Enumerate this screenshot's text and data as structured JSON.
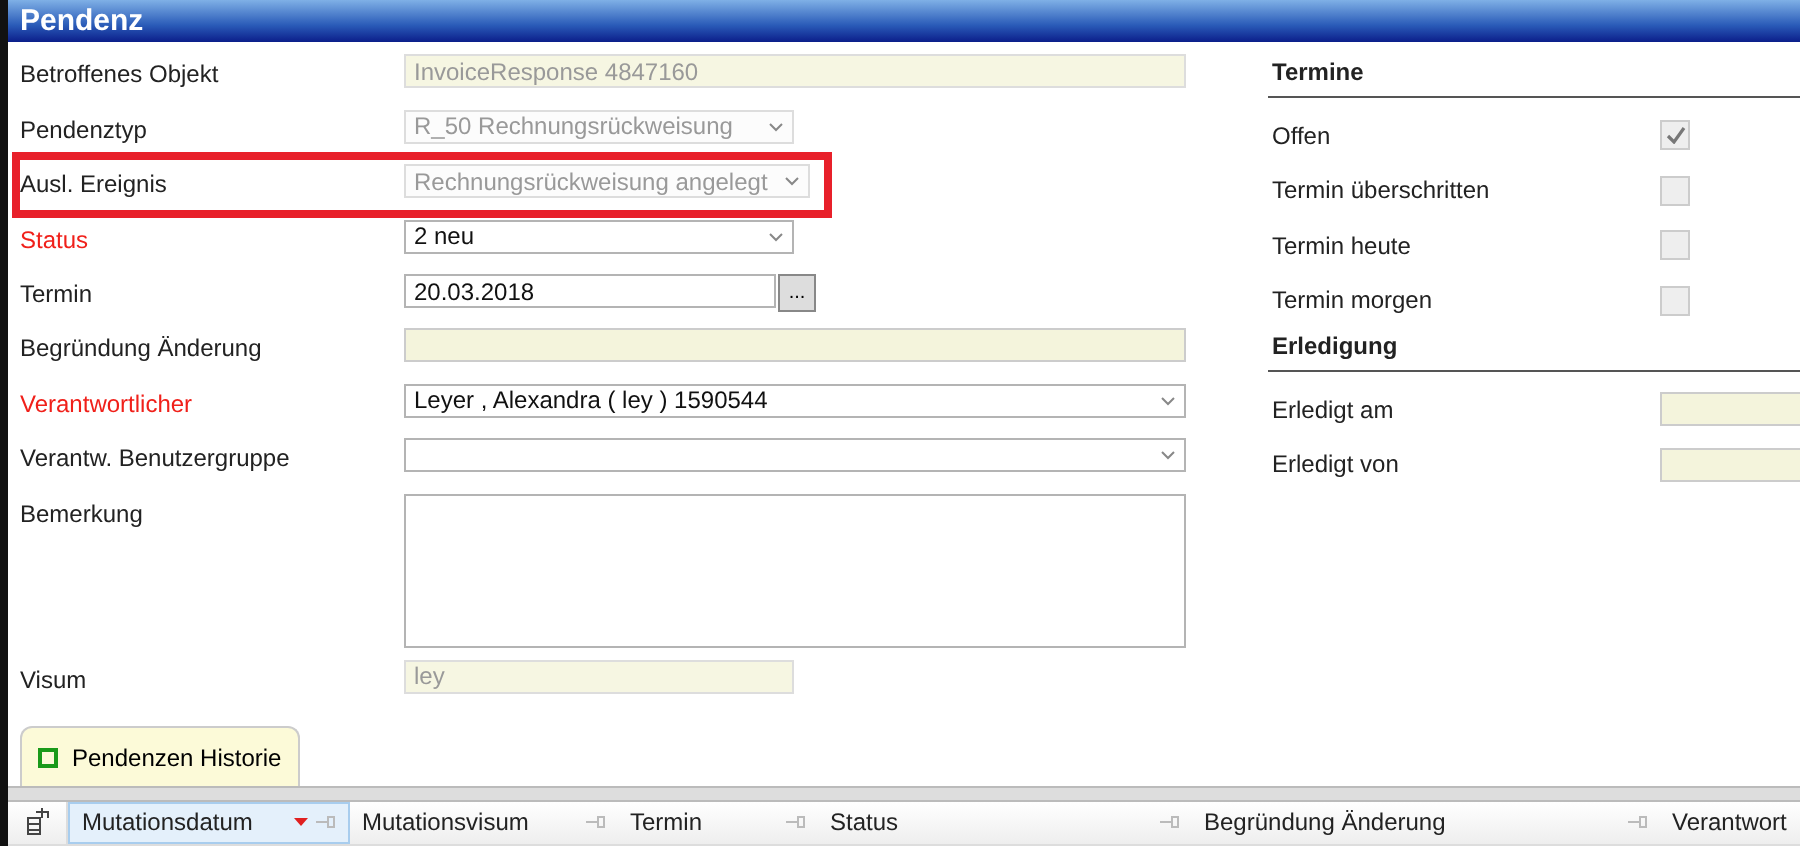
{
  "window": {
    "title": "Pendenz"
  },
  "fields": [
    {
      "label": "Betroffenes Objekt",
      "kind": "readonly",
      "value": "InvoiceResponse 4847160",
      "required": false,
      "disabled": true,
      "highlighted": false
    },
    {
      "label": "Pendenztyp",
      "kind": "select",
      "value": "R_50 Rechnungsrückweisung",
      "required": false,
      "disabled": true,
      "highlighted": false
    },
    {
      "label": "Ausl. Ereignis",
      "kind": "select",
      "value": "Rechnungsrückweisung angelegt",
      "required": false,
      "disabled": true,
      "highlighted": true
    },
    {
      "label": "Status",
      "kind": "select",
      "value": "2 neu",
      "required": true,
      "disabled": false,
      "highlighted": false
    },
    {
      "label": "Termin",
      "kind": "date",
      "value": "20.03.2018",
      "button": "...",
      "required": false,
      "disabled": false,
      "highlighted": false
    },
    {
      "label": "Begründung Änderung",
      "kind": "readonly",
      "required": false,
      "disabled": false,
      "highlighted": false
    },
    {
      "label": "Verantwortlicher",
      "kind": "select",
      "value": "Leyer , Alexandra  ( ley ) 1590544",
      "required": true,
      "disabled": false,
      "highlighted": false
    },
    {
      "label": "Verantw. Benutzergruppe",
      "kind": "select",
      "required": false,
      "disabled": false,
      "highlighted": false
    },
    {
      "label": "Bemerkung",
      "kind": "textarea",
      "required": false,
      "disabled": false,
      "highlighted": false
    },
    {
      "label": "Visum",
      "kind": "readonly",
      "value": "ley",
      "required": false,
      "disabled": true,
      "highlighted": false
    }
  ],
  "side_sections": [
    {
      "title": "Termine",
      "items": [
        {
          "label": "Offen",
          "kind": "checkbox",
          "checked": true
        },
        {
          "label": "Termin überschritten",
          "kind": "checkbox",
          "checked": false
        },
        {
          "label": "Termin heute",
          "kind": "checkbox",
          "checked": false
        },
        {
          "label": "Termin morgen",
          "kind": "checkbox",
          "checked": false
        }
      ]
    },
    {
      "title": "Erledigung",
      "items": [
        {
          "label": "Erledigt am",
          "kind": "field"
        },
        {
          "label": "Erledigt von",
          "kind": "field"
        }
      ]
    }
  ],
  "tabs": [
    {
      "label": "Pendenzen Historie",
      "selected": true
    }
  ],
  "table": {
    "columns": [
      {
        "label": "Mutationsdatum",
        "selected": true
      },
      {
        "label": "Mutationsvisum",
        "selected": false
      },
      {
        "label": "Termin",
        "selected": false
      },
      {
        "label": "Status",
        "selected": false
      },
      {
        "label": "Begründung Änderung",
        "selected": false
      },
      {
        "label": "Verantwort",
        "selected": false
      }
    ]
  }
}
